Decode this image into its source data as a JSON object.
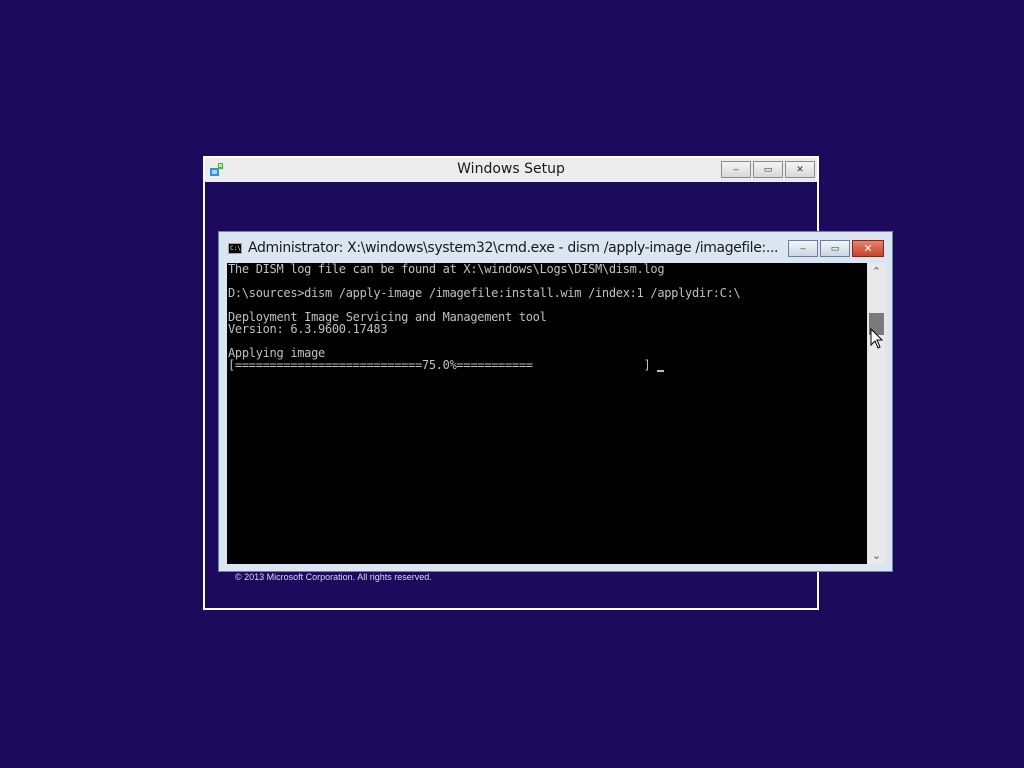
{
  "setup_window": {
    "title": "Windows Setup",
    "buttons": {
      "minimize": "‒",
      "restore": "▭",
      "close": "✕"
    },
    "copyright": "© 2013 Microsoft Corporation. All rights reserved."
  },
  "cmd_window": {
    "title": "Administrator: X:\\windows\\system32\\cmd.exe - dism  /apply-image /imagefile:...",
    "icon_text": "C:\\",
    "buttons": {
      "minimize": "‒",
      "maximize": "▭",
      "close": "✕"
    },
    "console_lines": [
      "The DISM log file can be found at X:\\windows\\Logs\\DISM\\dism.log",
      "",
      "D:\\sources>dism /apply-image /imagefile:install.wim /index:1 /applydir:C:\\",
      "",
      "Deployment Image Servicing and Management tool",
      "Version: 6.3.9600.17483",
      "",
      "Applying image"
    ],
    "progress_line": "[===========================75.0%===========                ] ",
    "progress_percent": 75.0,
    "scrollbar": {
      "up_arrow": "⌃",
      "down_arrow": "⌄"
    }
  },
  "colors": {
    "desktop_background": "#1c0a5c",
    "console_background": "#000000",
    "console_text": "#c0c0c0",
    "close_button": "#c7432b"
  },
  "icons": [
    "setup-app-icon",
    "cmd-icon",
    "mouse-pointer-icon"
  ]
}
